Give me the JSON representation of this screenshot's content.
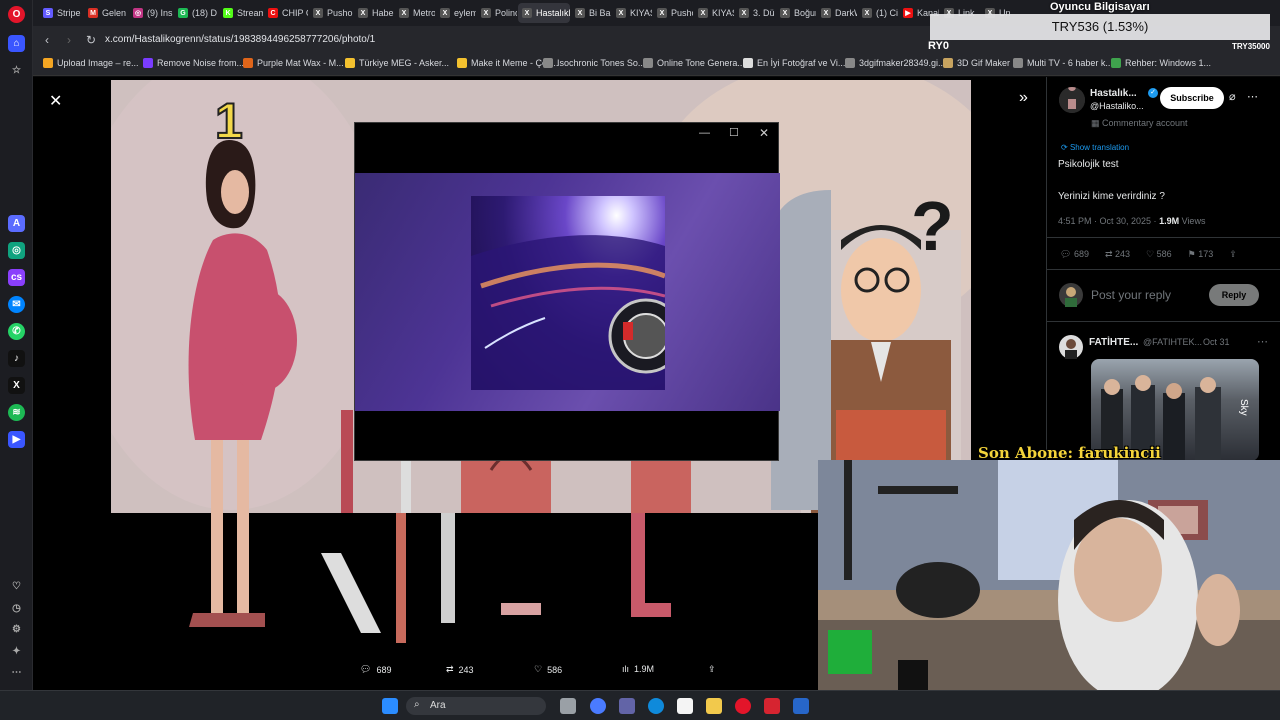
{
  "stream": {
    "pc_label": "Oyuncu Bilgisayarı",
    "price": "TRY536 (1.53%)",
    "ryo_label": "RY0",
    "try_small": "TRY35000",
    "last_sub": "Son Abone: farukincii"
  },
  "tabs": [
    {
      "label": "Stripe",
      "color": "#635bff",
      "glyph": "S"
    },
    {
      "label": "Gelen",
      "color": "#d93025",
      "glyph": "M"
    },
    {
      "label": "(9) Ins",
      "color": "#c13584",
      "glyph": "◎"
    },
    {
      "label": "(18) D",
      "color": "#1db954",
      "glyph": "G"
    },
    {
      "label": "Stream",
      "color": "#53fc18",
      "glyph": "K"
    },
    {
      "label": "CHIP C",
      "color": "#e11",
      "glyph": "C"
    },
    {
      "label": "Pusho",
      "color": "#555",
      "glyph": "X"
    },
    {
      "label": "Haber",
      "color": "#555",
      "glyph": "X"
    },
    {
      "label": "Metro",
      "color": "#555",
      "glyph": "X"
    },
    {
      "label": "eylem",
      "color": "#555",
      "glyph": "X"
    },
    {
      "label": "Polinc",
      "color": "#555",
      "glyph": "X"
    },
    {
      "label": "HastalıkNe",
      "color": "#555",
      "glyph": "X"
    },
    {
      "label": "Bi Bak",
      "color": "#555",
      "glyph": "X"
    },
    {
      "label": "KIYAS",
      "color": "#555",
      "glyph": "X"
    },
    {
      "label": "Pusho",
      "color": "#555",
      "glyph": "X"
    },
    {
      "label": "KIYAS",
      "color": "#555",
      "glyph": "X"
    },
    {
      "label": "3. Dün",
      "color": "#555",
      "glyph": "X"
    },
    {
      "label": "Boğun",
      "color": "#555",
      "glyph": "X"
    },
    {
      "label": "DarkW",
      "color": "#555",
      "glyph": "X"
    },
    {
      "label": "(1) Ci",
      "color": "#555",
      "glyph": "X"
    },
    {
      "label": "Kanal",
      "color": "#e11",
      "glyph": "▶"
    },
    {
      "label": "Link",
      "color": "#555",
      "glyph": "X"
    },
    {
      "label": "Un",
      "color": "#555",
      "glyph": "X"
    }
  ],
  "address": {
    "url": "x.com/Hastalikogrenn/status/1983894496258777206/photo/1"
  },
  "bookmarks": [
    {
      "label": "Upload Image – re...",
      "color": "#f5a623"
    },
    {
      "label": "Remove Noise from...",
      "color": "#7a3cff"
    },
    {
      "label": "Purple Mat Wax - M...",
      "color": "#e0651a"
    },
    {
      "label": "Türkiye MEG - Asker...",
      "color": "#f3c12f"
    },
    {
      "label": "Make it Meme - Çev...",
      "color": "#f3c12f"
    },
    {
      "label": "Isochronic Tones So...",
      "color": "#888"
    },
    {
      "label": "Online Tone Genera...",
      "color": "#888"
    },
    {
      "label": "En İyi Fotoğraf ve Vi...",
      "color": "#ddd"
    },
    {
      "label": "3dgifmaker28349.gi...",
      "color": "#888"
    },
    {
      "label": "3D Gif Maker",
      "color": "#c7a35f"
    },
    {
      "label": "Multi TV - 6 haber k...",
      "color": "#888"
    },
    {
      "label": "Rehber: Windows 1...",
      "color": "#3fa34d"
    }
  ],
  "photo": {
    "number": "1"
  },
  "tweet": {
    "author_name": "Hastalık...",
    "author_handle": "@Hastaliko...",
    "subscribe_label": "Subscribe",
    "account_type": "Commentary account",
    "show_translation": "Show translation",
    "text_line1": "Psikolojik test",
    "text_line2": "Yerinizi kime verirdiniz ?",
    "time": "4:51 PM · Oct 30, 2025 · ",
    "views_count": "1.9M",
    "views_label": "Views",
    "stats": {
      "replies": "689",
      "reposts": "243",
      "likes": "586",
      "bookmarks": "173"
    },
    "reply_placeholder": "Post your reply",
    "reply_button": "Reply"
  },
  "reply": {
    "name": "FATİHTE...",
    "handle": "@FATIHTEK...",
    "date": "Oct 31"
  },
  "bottom_bar": {
    "replies": "689",
    "reposts": "243",
    "likes": "586",
    "views": "1.9M"
  },
  "taskbar": {
    "search_label": "Ara"
  },
  "colors": {
    "accent": "#1d9bf0",
    "verified": "#1d9bf0",
    "sub_label": "#f4d43a"
  }
}
